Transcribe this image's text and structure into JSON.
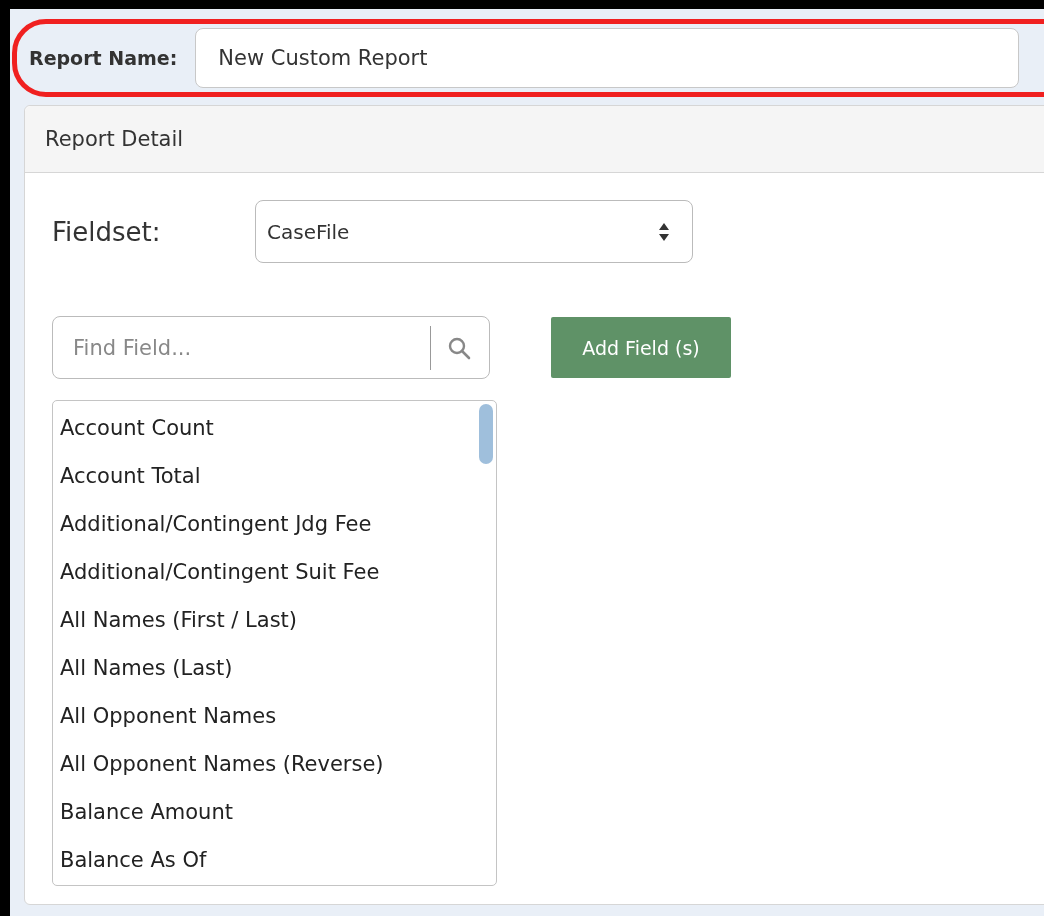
{
  "report_name": {
    "label": "Report Name:",
    "value": "New Custom Report",
    "highlighted": true
  },
  "panel": {
    "title": "Report Detail",
    "fieldset": {
      "label": "Fieldset:",
      "value": "CaseFile"
    },
    "search": {
      "placeholder": "Find Field..."
    },
    "add_button": "Add Field (s)",
    "fields": [
      {
        "label": "Account Count",
        "selected": false
      },
      {
        "label": "Account Total",
        "selected": false
      },
      {
        "label": "Additional/Contingent Jdg Fee",
        "selected": false
      },
      {
        "label": "Additional/Contingent Suit Fee",
        "selected": false
      },
      {
        "label": "All Names (First / Last)",
        "selected": false
      },
      {
        "label": "All Names (Last)",
        "selected": false
      },
      {
        "label": "All Opponent Names",
        "selected": false
      },
      {
        "label": "All Opponent Names (Reverse)",
        "selected": false
      },
      {
        "label": "Balance Amount",
        "selected": false
      },
      {
        "label": "Balance As Of",
        "selected": false
      }
    ]
  }
}
